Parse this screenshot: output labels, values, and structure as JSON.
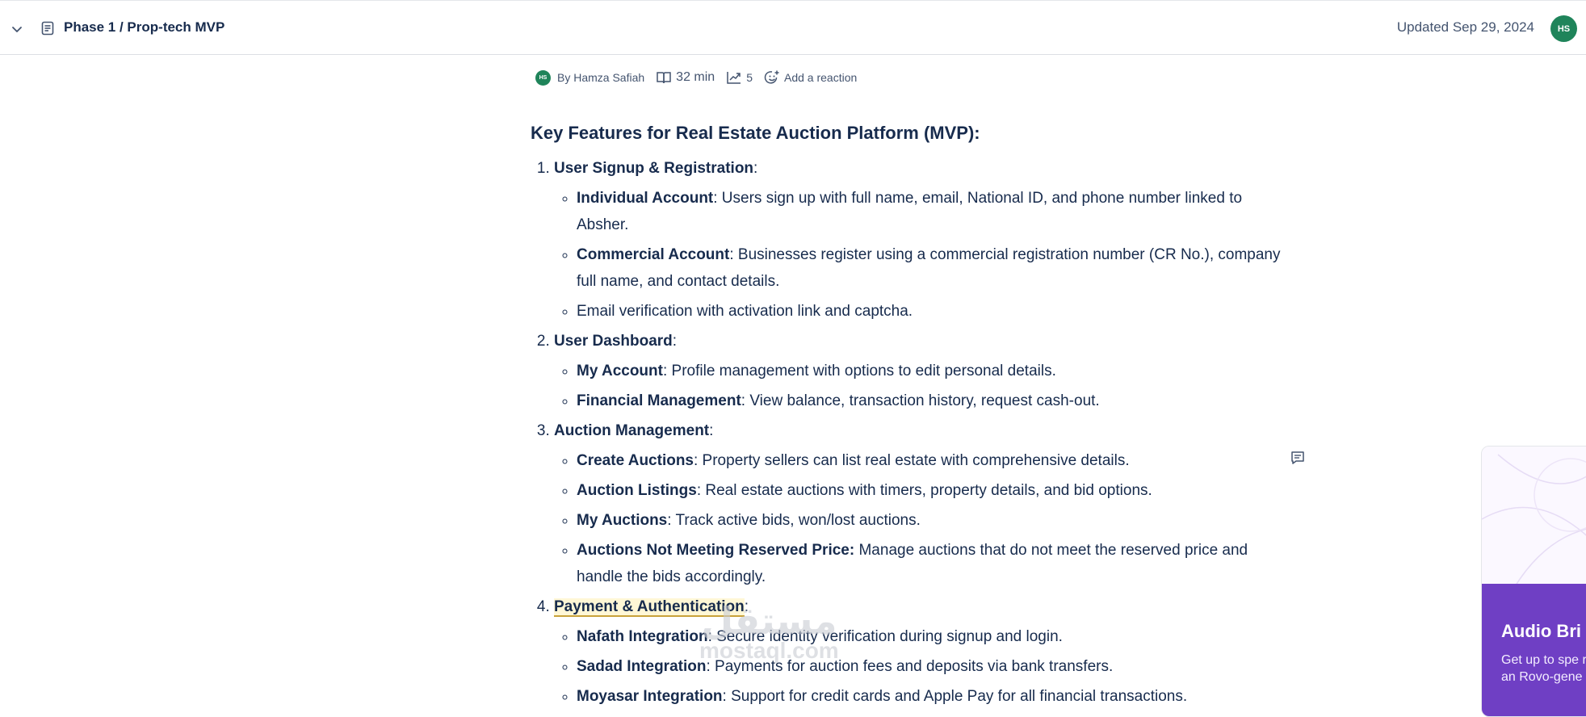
{
  "header": {
    "breadcrumb": "Phase 1 / Prop-tech MVP",
    "updated": "Updated Sep 29, 2024",
    "avatar_initials": "HS"
  },
  "byline": {
    "avatar_initials": "HS",
    "author": "By Hamza Safiah",
    "read_time": "32 min",
    "views": "5",
    "reaction": "Add a reaction"
  },
  "document": {
    "heading": "Key Features for Real Estate Auction Platform (MVP):",
    "sections": [
      {
        "title": "User Signup & Registration",
        "items": [
          {
            "bold": "Individual Account",
            "text": ": Users sign up with full name, email, National ID, and phone number linked to Absher."
          },
          {
            "bold": "Commercial Account",
            "text": ": Businesses register using a commercial registration number (CR No.), company full name, and contact details."
          },
          {
            "bold": "",
            "text": "Email verification with activation link and captcha."
          }
        ]
      },
      {
        "title": "User Dashboard",
        "items": [
          {
            "bold": "My Account",
            "text": ": Profile management with options to edit personal details."
          },
          {
            "bold": "Financial Management",
            "text": ": View balance, transaction history, request cash-out."
          }
        ]
      },
      {
        "title": "Auction Management",
        "items": [
          {
            "bold": "Create Auctions",
            "text": ": Property sellers can list real estate with comprehensive details."
          },
          {
            "bold": "Auction Listings",
            "text": ": Real estate auctions with timers, property details, and bid options."
          },
          {
            "bold": "My Auctions",
            "text": ": Track active bids, won/lost auctions."
          },
          {
            "bold": "Auctions Not Meeting Reserved Price:",
            "text": " Manage auctions that do not meet the reserved price and handle the bids accordingly."
          }
        ]
      },
      {
        "title": "Payment & Authentication",
        "items": [
          {
            "bold": "Nafath Integration",
            "text": ": Secure identity verification during signup and login."
          },
          {
            "bold": "Sadad Integration",
            "text": ": Payments for auction fees and deposits via bank transfers."
          },
          {
            "bold": "Moyasar Integration",
            "text": ": Support for credit cards and Apple Pay for all financial transactions."
          }
        ]
      }
    ]
  },
  "rovo_card": {
    "title": "Audio Bri",
    "description": "Get up to spe related to this an Rovo-gene"
  },
  "watermark": {
    "arabic": "مستقل",
    "latin": "mostaql.com"
  }
}
